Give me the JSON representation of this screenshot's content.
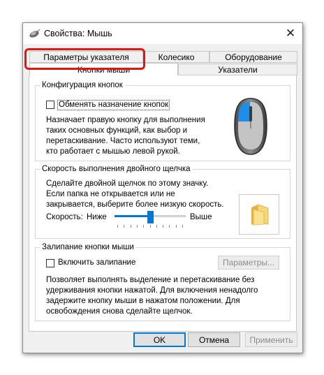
{
  "window": {
    "title": "Свойства: Мышь",
    "close_glyph": "✕"
  },
  "tabs": {
    "back_row": [
      "Параметры указателя",
      "Колесико",
      "Оборудование"
    ],
    "front_row": [
      "Кнопки мыши",
      "Указатели"
    ],
    "active": "Кнопки мыши",
    "highlighted": "Параметры указателя",
    "highlight_color": "#e21515"
  },
  "buttons_config": {
    "title": "Конфигурация кнопок",
    "checkbox_label": "Обменять назначение кнопок",
    "checked": false,
    "description": [
      "Назначает правую кнопку для выполнения",
      "таких основных функций, как выбор и",
      "перетаскивание. Часто используют теми,",
      "кто работает с мышью левой рукой."
    ],
    "mouse_icon": "mouse-left-button-icon",
    "accent_color": "#1e8ee6"
  },
  "double_click": {
    "title": "Скорость выполнения двойного щелчка",
    "description": [
      "Сделайте двойной щелчок по этому значку.",
      "Если папка не открывается или не",
      "закрывается, выберите более низкую скорость."
    ],
    "speed_label": "Скорость:",
    "slow_label": "Ниже",
    "fast_label": "Выше",
    "speed_value": 0.5,
    "folder_icon": "folder-icon"
  },
  "click_lock": {
    "title": "Залипание кнопки мыши",
    "checkbox_label": "Включить залипание",
    "checked": false,
    "settings_button": "Параметры...",
    "description": [
      "Позволяет выполнять выделение и перетаскивание без",
      "удерживания кнопки нажатой. Для включения ненадолго",
      "задержите кнопку мыши в нажатом положении. Для",
      "освобождения снова сделайте щелчок."
    ]
  },
  "dialog_buttons": {
    "ok": "OK",
    "cancel": "Отмена",
    "apply": "Применить"
  },
  "colors": {
    "accent": "#0078d7"
  }
}
